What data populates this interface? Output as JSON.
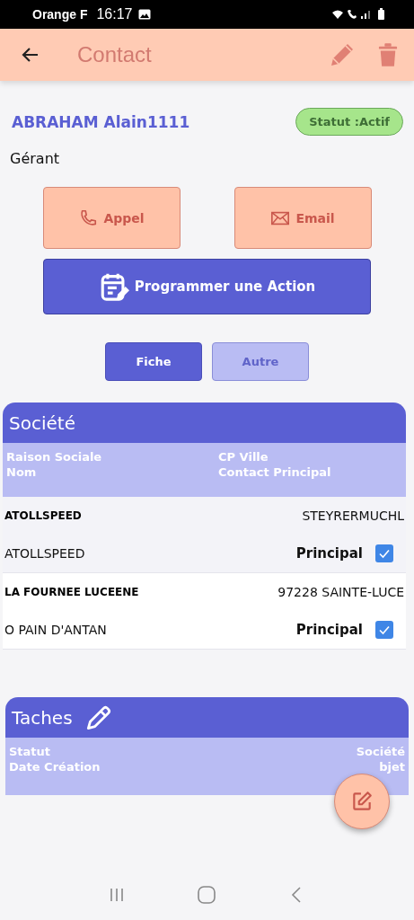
{
  "status_bar": {
    "carrier": "Orange F",
    "time": "16:17"
  },
  "app_bar": {
    "title": "Contact"
  },
  "contact": {
    "name": "ABRAHAM Alain1111",
    "status": "Statut :Actif",
    "role": "Gérant"
  },
  "actions": [
    {
      "kind": "call",
      "label": "Appel"
    },
    {
      "kind": "email",
      "label": "Email"
    },
    {
      "kind": "schedule",
      "label": "Programmer une Action"
    }
  ],
  "tabs": [
    {
      "label": "Fiche",
      "selected": true
    },
    {
      "label": "Autre",
      "selected": false
    }
  ],
  "societe": {
    "title": "Société",
    "columns": [
      [
        "Raison Sociale",
        "Nom"
      ],
      [
        "CP Ville",
        "Contact Principal"
      ]
    ],
    "rows": [
      {
        "raison_sociale": "ATOLLSPEED",
        "cp_ville": "STEYRERMUCHL",
        "nom": "ATOLLSPEED",
        "contact": "Principal",
        "checked": true
      },
      {
        "raison_sociale": "LA FOURNEE LUCEENE",
        "cp_ville": "97228 SAINTE-LUCE",
        "nom": "O PAIN D'ANTAN",
        "contact": "Principal",
        "checked": true
      }
    ]
  },
  "taches": {
    "title": "Taches",
    "columns": [
      [
        "Statut",
        "Date Création"
      ],
      [
        "Société",
        "bjet"
      ]
    ]
  }
}
